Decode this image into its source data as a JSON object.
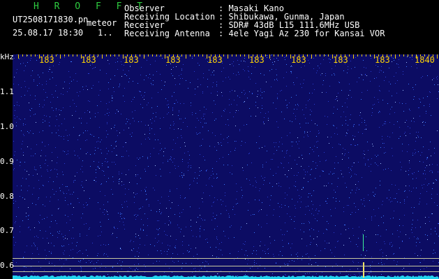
{
  "header": {
    "app_name": "H R O F F T",
    "filename": "UT2508171830.pn",
    "meteor_label": "meteor",
    "datetime": "25.08.17 18:30",
    "count": "1..",
    "fields": [
      {
        "label": "Observer",
        "value": ": Masaki Kano"
      },
      {
        "label": "Receiving Location",
        "value": ": Shibukawa, Gunma, Japan"
      },
      {
        "label": "Receiver",
        "value": ": SDR# 43dB L15 111.6MHz USB"
      },
      {
        "label": "Receiving Antenna",
        "value": ": 4ele Yagi Az 230 for Kansai VOR"
      }
    ]
  },
  "spectrogram": {
    "y_unit": "kHz",
    "y_ticks": [
      "1.1",
      "1.0",
      "0.9",
      "0.8",
      "0.7",
      "0.6"
    ],
    "x_ticks": [
      "183",
      "183",
      "183",
      "183",
      "183",
      "183",
      "183",
      "183",
      "183",
      "1840"
    ],
    "colors": {
      "background": "#0c0c63",
      "noise": "#3a78ff",
      "trace": "#22d3ee",
      "ticks": "#ffd400"
    }
  }
}
